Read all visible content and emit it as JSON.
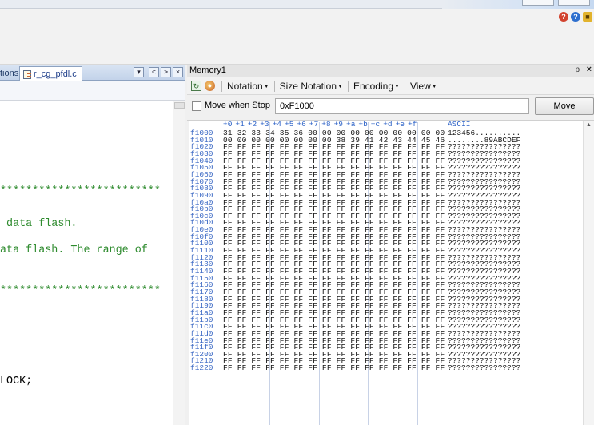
{
  "top_icons": [
    {
      "name": "help-balloon-icon",
      "glyph": "?",
      "color": "#d2432f"
    },
    {
      "name": "info-icon",
      "glyph": "?",
      "color": "#2e6fce"
    },
    {
      "name": "lock-icon",
      "glyph": "■",
      "color": "#e2b32d"
    }
  ],
  "editor": {
    "prev_tab_label": "tions",
    "active_tab_label": "r_cg_pfdl.c",
    "tab_controls": [
      "▾",
      "<",
      ">",
      "×"
    ],
    "code_lines": [
      {
        "text": "*************************",
        "color": "green"
      },
      {
        "text": " data flash.",
        "color": "green"
      },
      {
        "text": "ata flash. The range of",
        "color": "green"
      },
      {
        "text": "*************************",
        "color": "green"
      },
      {
        "text": "LOCK;",
        "color": "black"
      }
    ]
  },
  "memory": {
    "title": "Memory1",
    "pin_glyph": "ᵽ",
    "close_glyph": "×",
    "toolbar_menus": [
      "Notation",
      "Size Notation",
      "Encoding",
      "View"
    ],
    "move_when_stop_label": "Move when Stop",
    "address_value": "0xF1000",
    "move_button_label": "Move",
    "column_headers": [
      "+0",
      "+1",
      "+2",
      "+3",
      "+4",
      "+5",
      "+6",
      "+7",
      "+8",
      "+9",
      "+a",
      "+b",
      "+c",
      "+d",
      "+e",
      "+f"
    ],
    "ascii_header": "ASCII",
    "rows": [
      {
        "addr": "f1000",
        "hex": "31 32 33 34 35 36 00 00 00 00 00 00 00 00 00 00",
        "ascii": "123456.........."
      },
      {
        "addr": "f1010",
        "hex": "00 00 00 00 00 00 00 00 38 39 41 42 43 44 45 46",
        "ascii": "........89ABCDEF"
      },
      {
        "addr": "f1020",
        "hex": "FF FF FF FF FF FF FF FF FF FF FF FF FF FF FF FF",
        "ascii": "????????????????"
      },
      {
        "addr": "f1030",
        "hex": "FF FF FF FF FF FF FF FF FF FF FF FF FF FF FF FF",
        "ascii": "????????????????"
      },
      {
        "addr": "f1040",
        "hex": "FF FF FF FF FF FF FF FF FF FF FF FF FF FF FF FF",
        "ascii": "????????????????"
      },
      {
        "addr": "f1050",
        "hex": "FF FF FF FF FF FF FF FF FF FF FF FF FF FF FF FF",
        "ascii": "????????????????"
      },
      {
        "addr": "f1060",
        "hex": "FF FF FF FF FF FF FF FF FF FF FF FF FF FF FF FF",
        "ascii": "????????????????"
      },
      {
        "addr": "f1070",
        "hex": "FF FF FF FF FF FF FF FF FF FF FF FF FF FF FF FF",
        "ascii": "????????????????"
      },
      {
        "addr": "f1080",
        "hex": "FF FF FF FF FF FF FF FF FF FF FF FF FF FF FF FF",
        "ascii": "????????????????"
      },
      {
        "addr": "f1090",
        "hex": "FF FF FF FF FF FF FF FF FF FF FF FF FF FF FF FF",
        "ascii": "????????????????"
      },
      {
        "addr": "f10a0",
        "hex": "FF FF FF FF FF FF FF FF FF FF FF FF FF FF FF FF",
        "ascii": "????????????????"
      },
      {
        "addr": "f10b0",
        "hex": "FF FF FF FF FF FF FF FF FF FF FF FF FF FF FF FF",
        "ascii": "????????????????"
      },
      {
        "addr": "f10c0",
        "hex": "FF FF FF FF FF FF FF FF FF FF FF FF FF FF FF FF",
        "ascii": "????????????????"
      },
      {
        "addr": "f10d0",
        "hex": "FF FF FF FF FF FF FF FF FF FF FF FF FF FF FF FF",
        "ascii": "????????????????"
      },
      {
        "addr": "f10e0",
        "hex": "FF FF FF FF FF FF FF FF FF FF FF FF FF FF FF FF",
        "ascii": "????????????????"
      },
      {
        "addr": "f10f0",
        "hex": "FF FF FF FF FF FF FF FF FF FF FF FF FF FF FF FF",
        "ascii": "????????????????"
      },
      {
        "addr": "f1100",
        "hex": "FF FF FF FF FF FF FF FF FF FF FF FF FF FF FF FF",
        "ascii": "????????????????"
      },
      {
        "addr": "f1110",
        "hex": "FF FF FF FF FF FF FF FF FF FF FF FF FF FF FF FF",
        "ascii": "????????????????"
      },
      {
        "addr": "f1120",
        "hex": "FF FF FF FF FF FF FF FF FF FF FF FF FF FF FF FF",
        "ascii": "????????????????"
      },
      {
        "addr": "f1130",
        "hex": "FF FF FF FF FF FF FF FF FF FF FF FF FF FF FF FF",
        "ascii": "????????????????"
      },
      {
        "addr": "f1140",
        "hex": "FF FF FF FF FF FF FF FF FF FF FF FF FF FF FF FF",
        "ascii": "????????????????"
      },
      {
        "addr": "f1150",
        "hex": "FF FF FF FF FF FF FF FF FF FF FF FF FF FF FF FF",
        "ascii": "????????????????"
      },
      {
        "addr": "f1160",
        "hex": "FF FF FF FF FF FF FF FF FF FF FF FF FF FF FF FF",
        "ascii": "????????????????"
      },
      {
        "addr": "f1170",
        "hex": "FF FF FF FF FF FF FF FF FF FF FF FF FF FF FF FF",
        "ascii": "????????????????"
      },
      {
        "addr": "f1180",
        "hex": "FF FF FF FF FF FF FF FF FF FF FF FF FF FF FF FF",
        "ascii": "????????????????"
      },
      {
        "addr": "f1190",
        "hex": "FF FF FF FF FF FF FF FF FF FF FF FF FF FF FF FF",
        "ascii": "????????????????"
      },
      {
        "addr": "f11a0",
        "hex": "FF FF FF FF FF FF FF FF FF FF FF FF FF FF FF FF",
        "ascii": "????????????????"
      },
      {
        "addr": "f11b0",
        "hex": "FF FF FF FF FF FF FF FF FF FF FF FF FF FF FF FF",
        "ascii": "????????????????"
      },
      {
        "addr": "f11c0",
        "hex": "FF FF FF FF FF FF FF FF FF FF FF FF FF FF FF FF",
        "ascii": "????????????????"
      },
      {
        "addr": "f11d0",
        "hex": "FF FF FF FF FF FF FF FF FF FF FF FF FF FF FF FF",
        "ascii": "????????????????"
      },
      {
        "addr": "f11e0",
        "hex": "FF FF FF FF FF FF FF FF FF FF FF FF FF FF FF FF",
        "ascii": "????????????????"
      },
      {
        "addr": "f11f0",
        "hex": "FF FF FF FF FF FF FF FF FF FF FF FF FF FF FF FF",
        "ascii": "????????????????"
      },
      {
        "addr": "f1200",
        "hex": "FF FF FF FF FF FF FF FF FF FF FF FF FF FF FF FF",
        "ascii": "????????????????"
      },
      {
        "addr": "f1210",
        "hex": "FF FF FF FF FF FF FF FF FF FF FF FF FF FF FF FF",
        "ascii": "????????????????"
      },
      {
        "addr": "f1220",
        "hex": "FF FF FF FF FF FF FF FF FF FF FF FF FF FF FF FF",
        "ascii": "????????????????"
      }
    ]
  },
  "colors": {
    "address_blue": "#3a68c4",
    "header_blue": "#2c62c7",
    "code_green": "#2e8b2e"
  }
}
